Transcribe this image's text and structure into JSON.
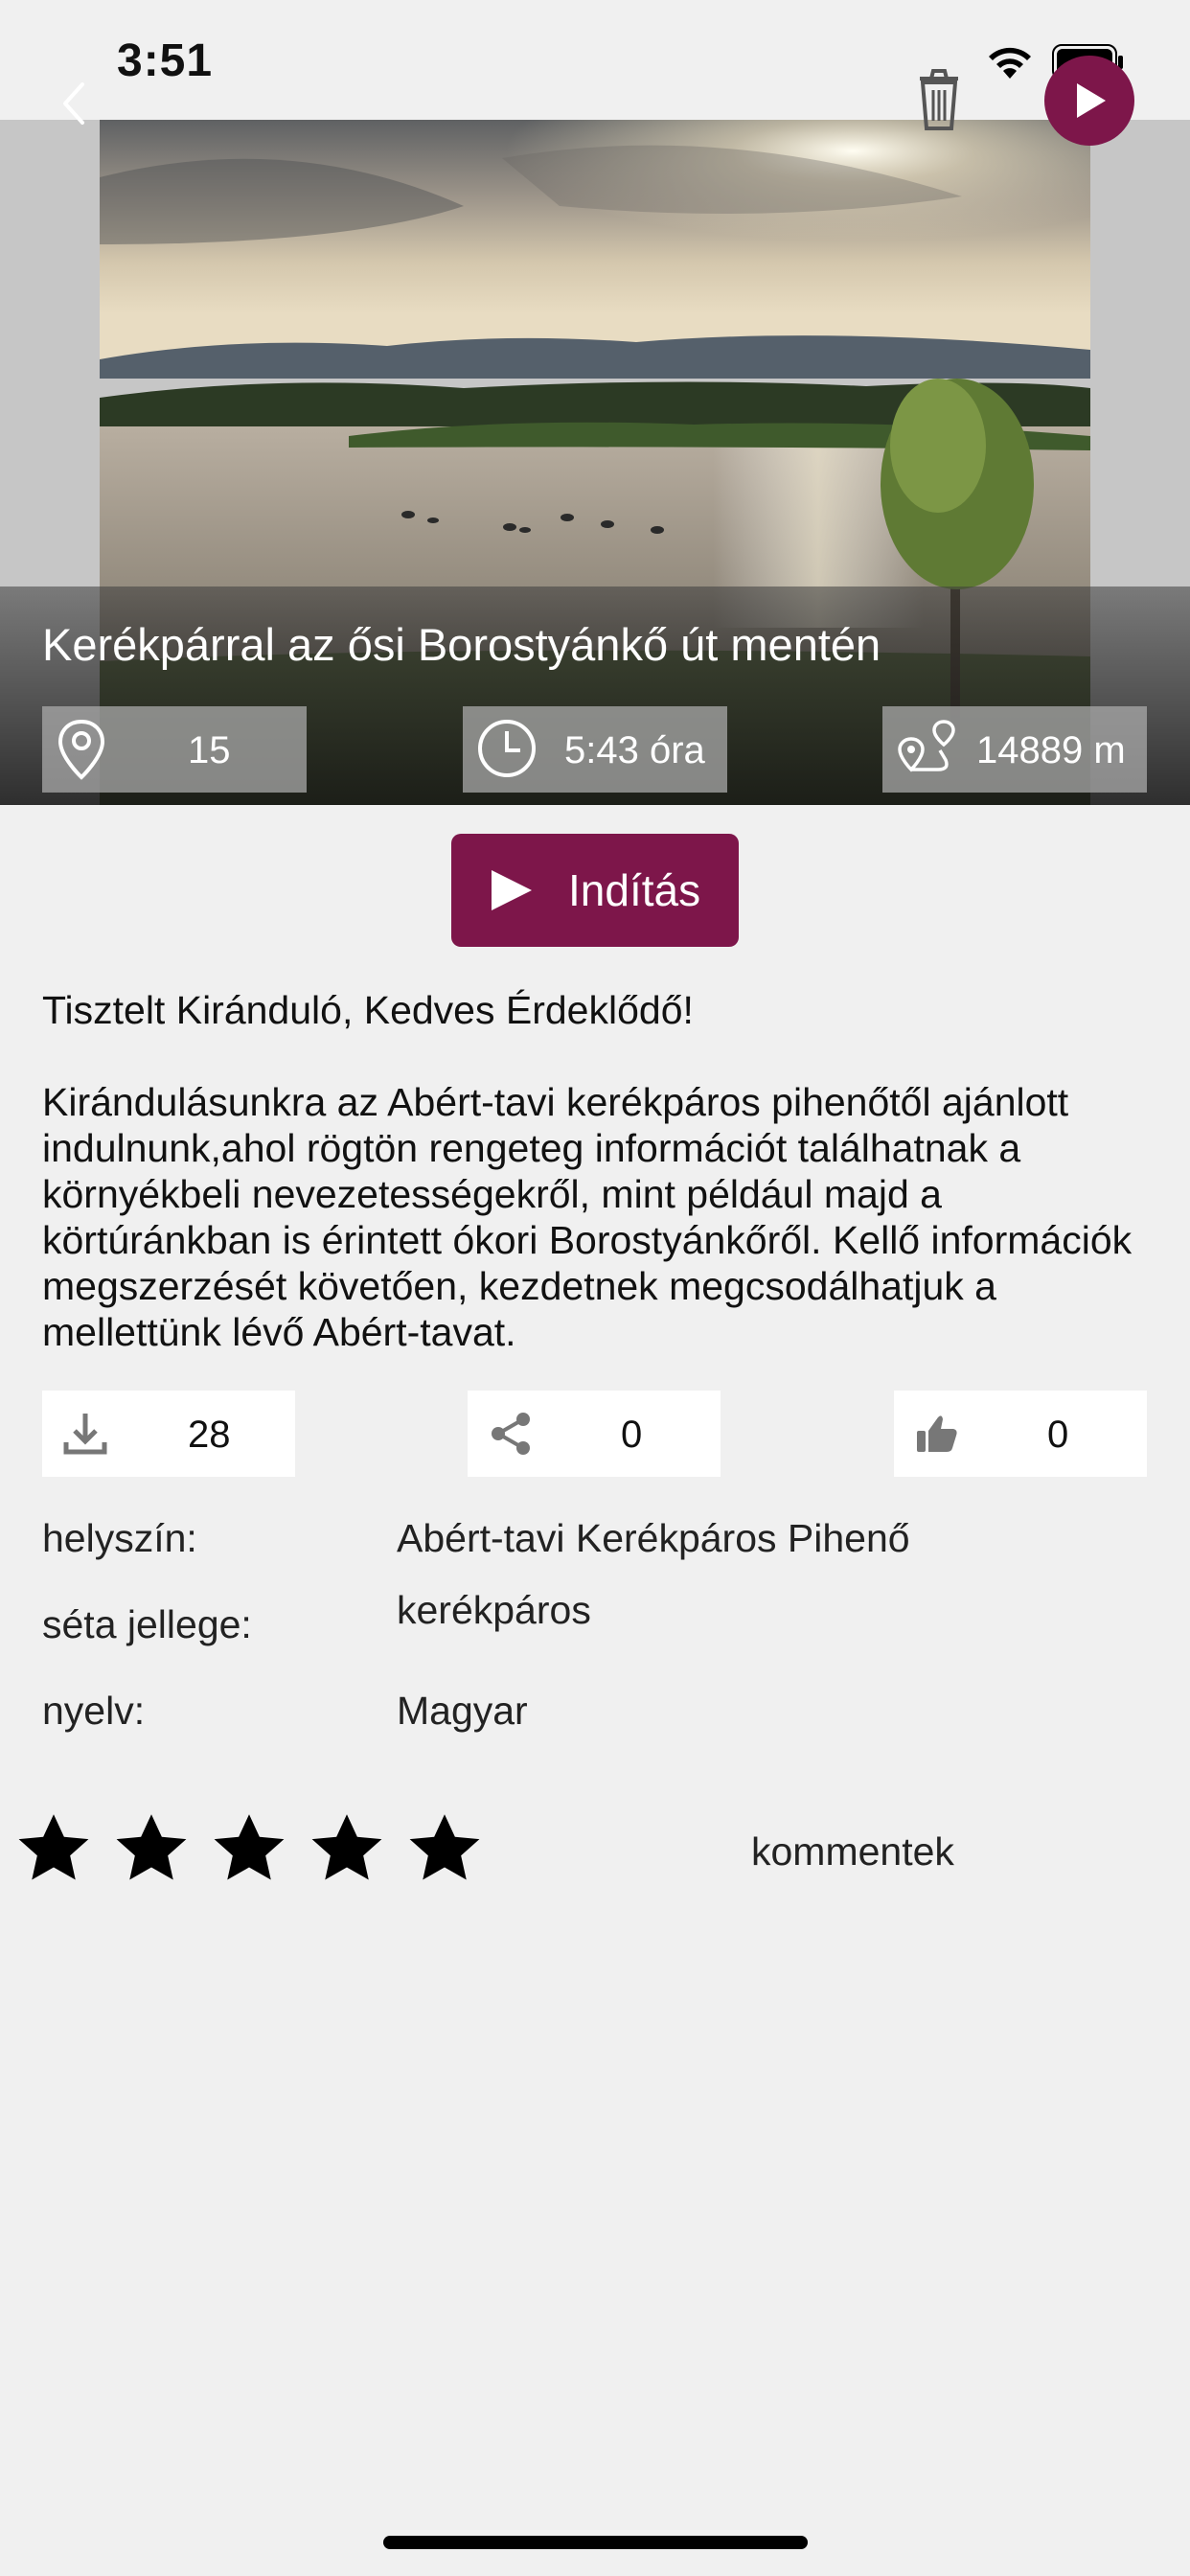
{
  "status_bar": {
    "time": "3:51"
  },
  "icons": {
    "back": "chevron-left-icon",
    "trash": "trash-icon",
    "play": "play-icon",
    "location": "map-pin-icon",
    "duration": "clock-icon",
    "distance": "route-icon",
    "download": "download-icon",
    "share": "share-icon",
    "like": "thumbs-up-icon",
    "star": "star-icon"
  },
  "colors": {
    "accent": "#7d164a",
    "background": "#f0f0f0"
  },
  "hero": {
    "title": "Kerékpárral az ősi Borostyánkő út mentén",
    "stats": {
      "points": "15",
      "duration": "5:43 óra",
      "distance": "14889 m"
    }
  },
  "start_button": {
    "label": "Indítás"
  },
  "greeting": "Tisztelt Kiránduló, Kedves Érdeklődő!",
  "description": "Kirándulásunkra az Abért-tavi kerékpáros pihenőtől ajánlott indulnunk,ahol rögtön rengeteg információt találhatnak a környékbeli nevezetességekről, mint például majd a körtúránkban is érintett ókori Borostyánkőről. Kellő információk megszerzését követően, kezdetnek megcsodálhatjuk a mellettünk lévő Abért-tavat.",
  "actions": {
    "downloads": "28",
    "shares": "0",
    "likes": "0"
  },
  "meta": {
    "location_label": "helyszín:",
    "location_value": "Abért-tavi Kerékpáros Pihenő",
    "type_label": "séta jellege:",
    "type_value": "kerékpáros",
    "language_label": "nyelv:",
    "language_value": "Magyar"
  },
  "rating": {
    "stars": 5
  },
  "comments_label": "kommentek"
}
